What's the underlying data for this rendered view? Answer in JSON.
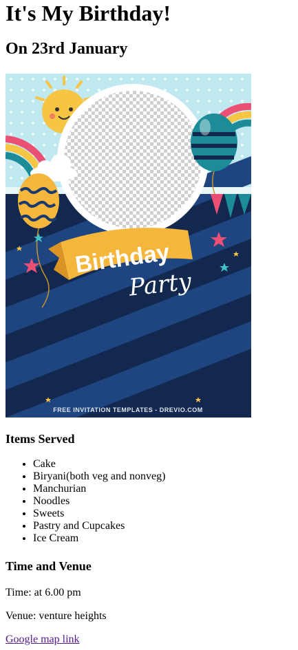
{
  "page": {
    "title": "It's My Birthday!",
    "subtitle": "On 23rd January"
  },
  "invite_image": {
    "headline_word1": "Birthday",
    "headline_word2": "Party",
    "footer_text": "FREE INVITATION TEMPLATES - DREVIO.COM",
    "colors": {
      "sky": "#bfe8f0",
      "navy": "#12284e",
      "stripe": "#1e4580",
      "ribbon": "#f5b63c",
      "sun": "#f7c544",
      "teal_balloon": "#1b8c98",
      "pink_star": "#ec4f74"
    }
  },
  "items_section": {
    "heading": "Items Served",
    "items": [
      "Cake",
      "Biryani(both veg and nonveg)",
      "Manchurian",
      "Noodles",
      "Sweets",
      "Pastry and Cupcakes",
      "Ice Cream"
    ]
  },
  "time_venue": {
    "heading": "Time and Venue",
    "time_text": "Time: at 6.00 pm",
    "venue_text": "Venue: venture heights",
    "map_link_text": "Google map link"
  }
}
